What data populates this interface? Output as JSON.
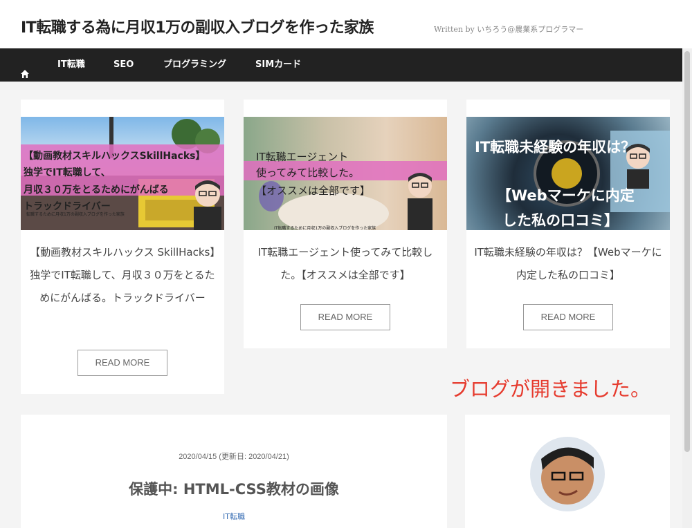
{
  "header": {
    "site_title": "IT転職する為に月収1万の副収入ブログを作った家族",
    "tagline": "Written by いちろう@農業系プログラマー"
  },
  "nav": {
    "home_icon": "home-icon",
    "items": [
      "IT転職",
      "SEO",
      "プログラミング",
      "SIMカード"
    ]
  },
  "cards": [
    {
      "thumb_lines": [
        "【動画教材スキルハックスSkillHacks】",
        "独学でIT転職して、",
        "月収３０万をとるためにがんばる",
        "トラックドライバー"
      ],
      "thumb_footer": "転職するために月収1万の副収入ブログを作った家族",
      "title": "【動画教材スキルハックス SkillHacks】独学でIT転職して、月収３０万をとるためにがんばる。トラックドライバー",
      "read_more": "READ MORE"
    },
    {
      "thumb_lines": [
        "IT転職エージェント",
        "使ってみて比較した。",
        "【オススメは全部です】"
      ],
      "thumb_footer": "IT転職するために月収1万の副収入ブログを作った家族",
      "title": "IT転職エージェント使ってみて比較した。【オススメは全部です】",
      "read_more": "READ MORE"
    },
    {
      "thumb_lines": [
        "IT転職未経験の年収は？",
        "【Webマーケに内定",
        "した私の口コミ】"
      ],
      "title": "IT転職未経験の年収は？【Webマーケに内定した私の口コミ】",
      "read_more": "READ MORE"
    }
  ],
  "notice": "ブログが開きました。",
  "post": {
    "date": "2020/04/15 (更新日: 2020/04/21)",
    "title": "保護中: HTML-CSS教材の画像",
    "category": "IT転職"
  },
  "colors": {
    "nav_bg": "#222222",
    "notice": "#e63b2e",
    "category_link": "#3a6fb5",
    "thumb_band": "#e06fc0"
  }
}
